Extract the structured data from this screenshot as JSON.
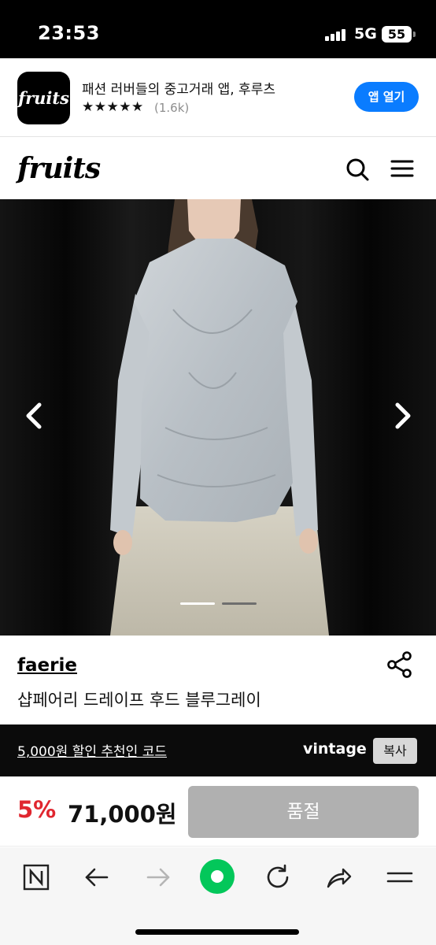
{
  "status_bar": {
    "time": "23:53",
    "network": "5G",
    "battery": "55"
  },
  "app_banner": {
    "icon_text": "fruits",
    "title": "패션 러버들의 중고거래 앱, 후루츠",
    "stars": "★★★★★",
    "rating_count": "(1.6k)",
    "open_button": "앱 열기"
  },
  "header": {
    "logo": "fruits",
    "search_icon": "search-icon",
    "menu_icon": "hamburger-menu-icon"
  },
  "carousel": {
    "slide_count": 2,
    "active_index": 0,
    "prev_icon": "chevron-left-icon",
    "next_icon": "chevron-right-icon"
  },
  "product": {
    "brand": "faerie",
    "title": "샵페어리 드레이프 후드 블루그레이",
    "share_icon": "share-icon"
  },
  "promo": {
    "text": "5,000원 할인 추천인 코드",
    "code": "vintage",
    "copy_button": "복사"
  },
  "price": {
    "discount": "5%",
    "amount": "71,000원",
    "status_button": "품절"
  },
  "browser_toolbar": {
    "items": [
      "naver-n-icon",
      "back-arrow-icon",
      "forward-arrow-icon",
      "green-dot-icon",
      "refresh-icon",
      "share-arrow-icon",
      "menu-icon"
    ]
  },
  "colors": {
    "accent": "#0a7cff",
    "discount": "#e0262f",
    "green": "#03c75a"
  }
}
